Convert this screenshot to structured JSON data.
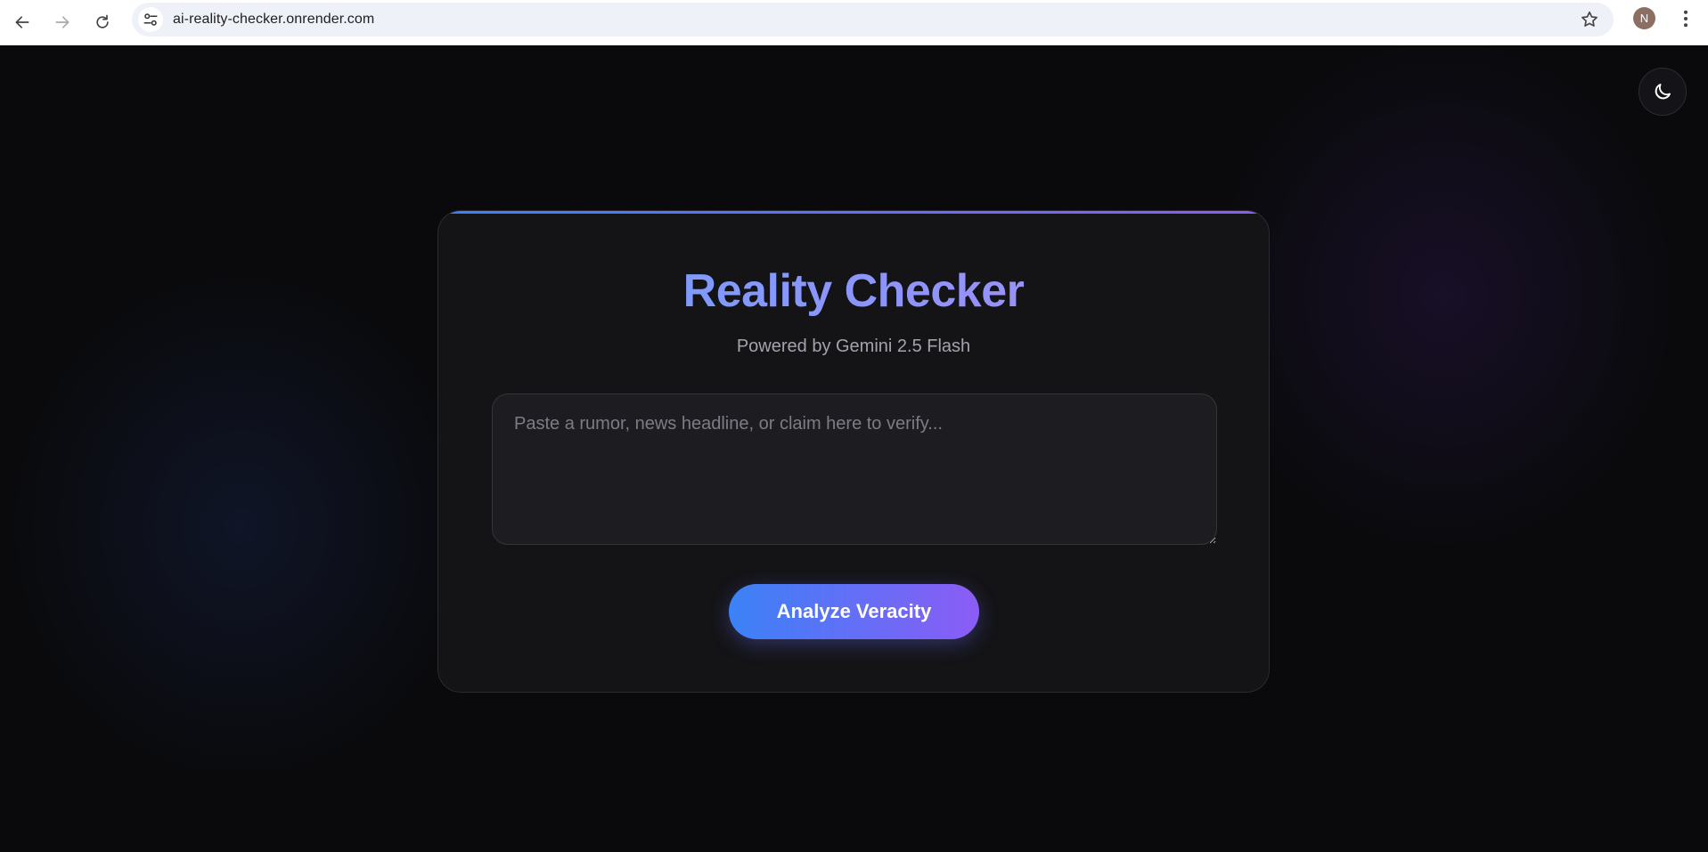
{
  "browser": {
    "url": "ai-reality-checker.onrender.com",
    "profile_initial": "N"
  },
  "page": {
    "title": "Reality Checker",
    "subtitle": "Powered by Gemini 2.5 Flash",
    "input": {
      "value": "",
      "placeholder": "Paste a rumor, news headline, or claim here to verify..."
    },
    "analyze_label": "Analyze Veracity",
    "theme_toggle_icon": "moon-icon"
  },
  "colors": {
    "background": "#0a0a0c",
    "card": "#141417",
    "accent_start": "#3b82f6",
    "accent_end": "#8b5cf6"
  }
}
